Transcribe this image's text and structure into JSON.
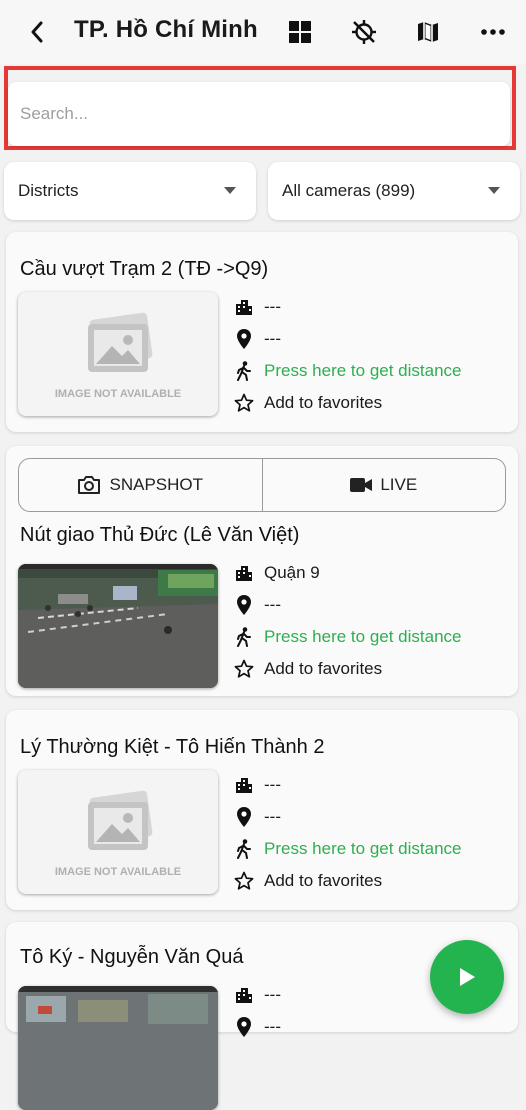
{
  "header": {
    "title": "TP. Hồ Chí Minh"
  },
  "search": {
    "placeholder": "Search..."
  },
  "filters": {
    "district": "Districts",
    "cameras": "All cameras (899)"
  },
  "segment": {
    "snapshot": "SNAPSHOT",
    "live": "LIVE"
  },
  "image_not_available": "IMAGE NOT AVAILABLE",
  "cameras": [
    {
      "title": "Cầu vượt Trạm 2 (TĐ ->Q9)",
      "district": "---",
      "location": "---",
      "distance": "Press here to get distance",
      "favorite": "Add to favorites"
    },
    {
      "title": "Nút giao Thủ Đức (Lê Văn Việt)",
      "district": "Quận 9",
      "location": "---",
      "distance": "Press here to get distance",
      "favorite": "Add to favorites"
    },
    {
      "title": "Lý Thường Kiệt - Tô Hiến Thành 2",
      "district": "---",
      "location": "---",
      "distance": "Press here to get distance",
      "favorite": "Add to favorites"
    },
    {
      "title": "Tô Ký - Nguyễn Văn Quá",
      "district": "---",
      "location": "---"
    }
  ],
  "colors": {
    "accent_green": "#2eaf4f",
    "fab_green": "#24b44f",
    "highlight_red": "#e53935"
  },
  "icons": [
    "back-icon",
    "grid-icon",
    "location-off-icon",
    "map-icon",
    "more-icon",
    "building-icon",
    "pin-icon",
    "walk-icon",
    "star-outline-icon",
    "camera-icon",
    "video-icon",
    "play-icon",
    "image-placeholder-icon"
  ]
}
